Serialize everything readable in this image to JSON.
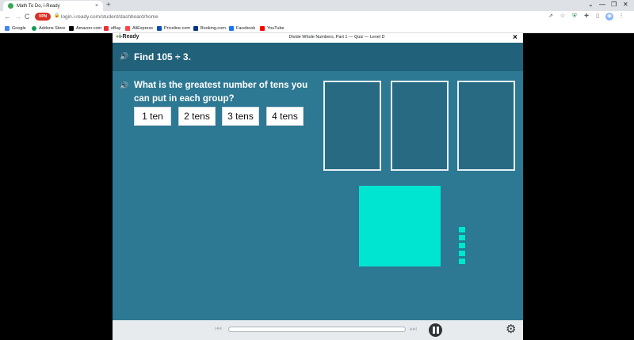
{
  "browser": {
    "tab_title": "Math To Do, i-Ready",
    "tab_close": "×",
    "new_tab": "+",
    "window_controls": [
      "⌄",
      "—",
      "❐",
      "✕"
    ],
    "nav": {
      "back": "←",
      "forward": "→",
      "reload": "C"
    },
    "vpn_label": "VPN",
    "url": "login.i-ready.com/student/dashboard/home",
    "bookmarks": [
      {
        "label": "Google",
        "color": "#4285f4"
      },
      {
        "label": "Addons Store",
        "color": "#0f9d58"
      },
      {
        "label": "Amazon.com",
        "color": "#000000"
      },
      {
        "label": "eBay",
        "color": "#e53238"
      },
      {
        "label": "AliExpress",
        "color": "#ff4747"
      },
      {
        "label": "Priceline.com",
        "color": "#0a4fb8"
      },
      {
        "label": "Booking.com",
        "color": "#003580"
      },
      {
        "label": "Facebook",
        "color": "#1877f2"
      },
      {
        "label": "YouTube",
        "color": "#ff0000"
      }
    ]
  },
  "app": {
    "logo": {
      "dot": "●",
      "text": "i-Ready"
    },
    "lesson_title": "Divide Whole Numbers, Part 1 — Quiz — Level D",
    "close": "×",
    "speaker": "🔊",
    "prompt": "Find 105 ÷ 3.",
    "question": "What is the greatest number of tens you can put in each group?",
    "options": [
      "1 ten",
      "2 tens",
      "3 tens",
      "4 tens"
    ],
    "colors": {
      "panel": "#2d7893",
      "header_bar": "#21617a",
      "blocks": "#00e5d2"
    },
    "model": {
      "hundreds": 1,
      "tens": 0,
      "ones": 5,
      "groups": 3
    }
  },
  "player": {
    "rewind": "⏮",
    "fast_forward": "⏭",
    "settings": "⚙"
  }
}
